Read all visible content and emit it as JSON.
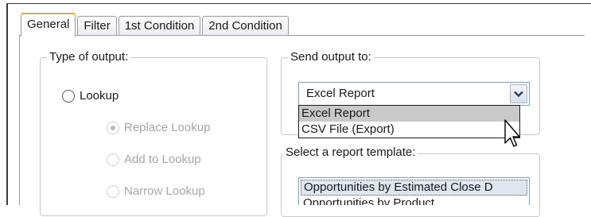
{
  "tabs": [
    {
      "label": "General",
      "active": true
    },
    {
      "label": "Filter",
      "active": false
    },
    {
      "label": "1st Condition",
      "active": false
    },
    {
      "label": "2nd Condition",
      "active": false
    }
  ],
  "type_of_output": {
    "title": "Type of output:",
    "lookup_label": "Lookup",
    "replace_lookup_label": "Replace Lookup",
    "add_to_lookup_label": "Add to Lookup",
    "narrow_lookup_label": "Narrow Lookup"
  },
  "send_output": {
    "title": "Send output to:",
    "selected": "Excel Report",
    "options": [
      "Excel Report",
      "CSV File (Export)"
    ]
  },
  "report_template": {
    "title": "Select a report template:",
    "items": [
      "Opportunities by Estimated Close D",
      "Opportunities by Product"
    ]
  },
  "colors": {
    "active_tab_accent": "#f2a03a",
    "dropdown_highlight": "#c9c9c9",
    "disabled_text": "#a6a6a6"
  }
}
